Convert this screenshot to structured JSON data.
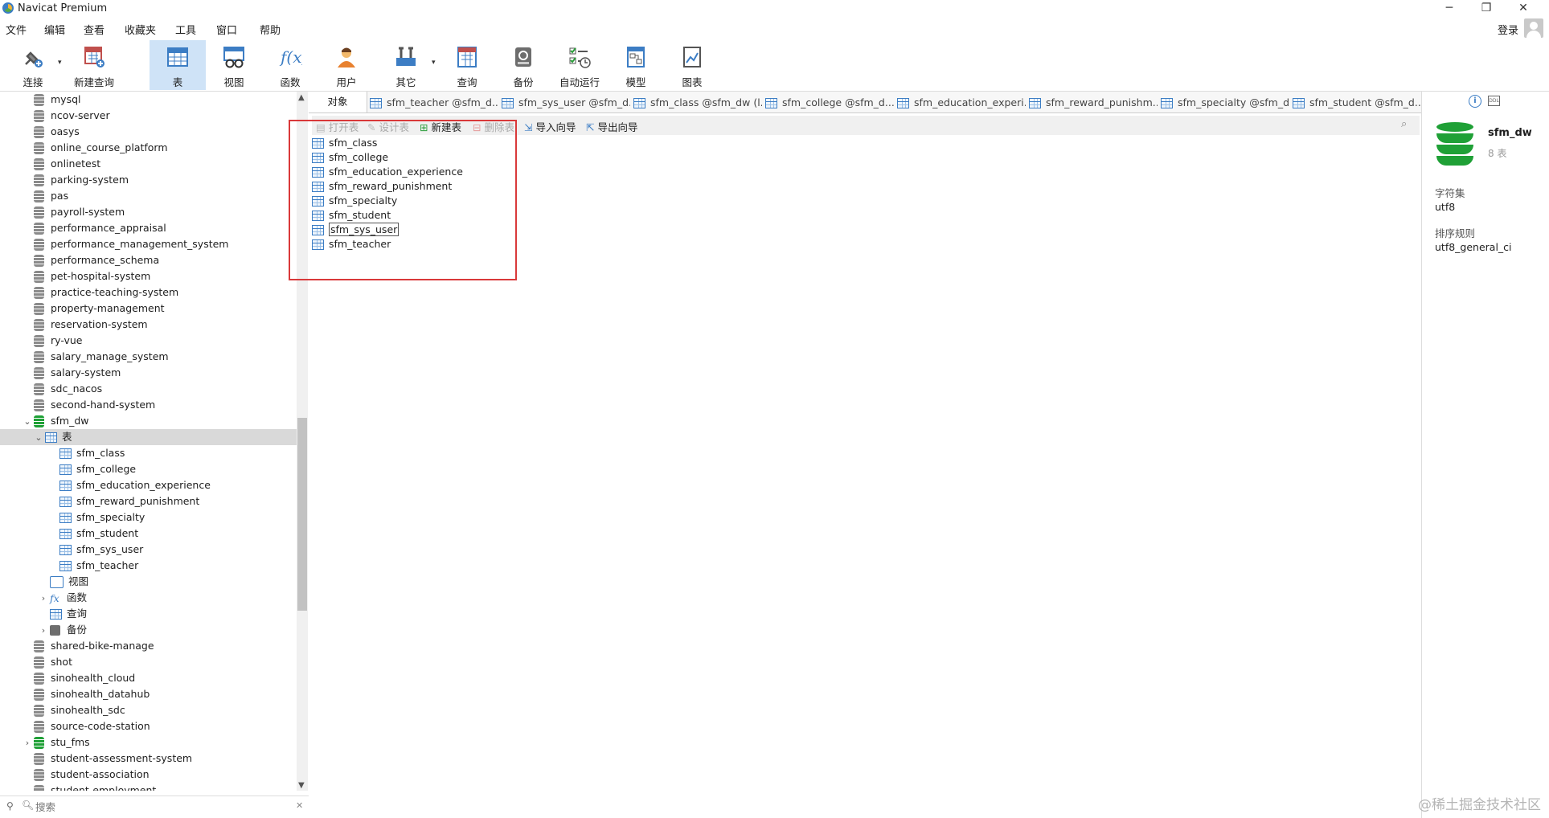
{
  "window": {
    "title": "Navicat Premium",
    "login_label": "登录"
  },
  "menu": [
    "文件",
    "编辑",
    "查看",
    "收藏夹",
    "工具",
    "窗口",
    "帮助"
  ],
  "toolbar": [
    {
      "label": "连接",
      "icon": "plug-icon"
    },
    {
      "label": "新建查询",
      "icon": "new-query-icon"
    },
    {
      "label": "表",
      "icon": "table-icon"
    },
    {
      "label": "视图",
      "icon": "view-icon"
    },
    {
      "label": "函数",
      "icon": "function-icon"
    },
    {
      "label": "用户",
      "icon": "user-icon"
    },
    {
      "label": "其它",
      "icon": "tools-icon"
    },
    {
      "label": "查询",
      "icon": "query-icon"
    },
    {
      "label": "备份",
      "icon": "backup-icon"
    },
    {
      "label": "自动运行",
      "icon": "schedule-icon"
    },
    {
      "label": "模型",
      "icon": "model-icon"
    },
    {
      "label": "图表",
      "icon": "chart-icon"
    }
  ],
  "tree": {
    "databases_before": [
      "mysql",
      "ncov-server",
      "oasys",
      "online_course_platform",
      "onlinetest",
      "parking-system",
      "pas",
      "payroll-system",
      "performance_appraisal",
      "performance_management_system",
      "performance_schema",
      "pet-hospital-system",
      "practice-teaching-system",
      "property-management",
      "reservation-system",
      "ry-vue",
      "salary_manage_system",
      "salary-system",
      "sdc_nacos",
      "second-hand-system"
    ],
    "open_db": "sfm_dw",
    "tables_label": "表",
    "tables": [
      "sfm_class",
      "sfm_college",
      "sfm_education_experience",
      "sfm_reward_punishment",
      "sfm_specialty",
      "sfm_student",
      "sfm_sys_user",
      "sfm_teacher"
    ],
    "other_nodes": [
      "视图",
      "函数",
      "查询",
      "备份"
    ],
    "databases_after": [
      "shared-bike-manage",
      "shot",
      "sinohealth_cloud",
      "sinohealth_datahub",
      "sinohealth_sdc",
      "source-code-station",
      "stu_fms",
      "student-assessment-system",
      "student-association",
      "student-employment"
    ],
    "search_placeholder": "搜索"
  },
  "tabs": [
    "对象",
    "sfm_teacher @sfm_d...",
    "sfm_sys_user @sfm_d...",
    "sfm_class @sfm_dw (l...",
    "sfm_college @sfm_d...",
    "sfm_education_experi...",
    "sfm_reward_punishm...",
    "sfm_specialty @sfm_d...",
    "sfm_student @sfm_d..."
  ],
  "object_toolbar": {
    "open": "打开表",
    "design": "设计表",
    "new": "新建表",
    "delete": "删除表",
    "import": "导入向导",
    "export": "导出向导"
  },
  "objects": [
    "sfm_class",
    "sfm_college",
    "sfm_education_experience",
    "sfm_reward_punishment",
    "sfm_specialty",
    "sfm_student",
    "sfm_sys_user",
    "sfm_teacher"
  ],
  "info_panel": {
    "db_name": "sfm_dw",
    "count": "8 表",
    "charset_label": "字符集",
    "charset": "utf8",
    "collation_label": "排序规则",
    "collation": "utf8_general_ci"
  },
  "watermark": "@稀土掘金技术社区",
  "colors": {
    "accent": "#3c7dc4",
    "active_tab": "#cfe3f7",
    "db_green": "#1fa036",
    "highlight": "#d9393a"
  }
}
